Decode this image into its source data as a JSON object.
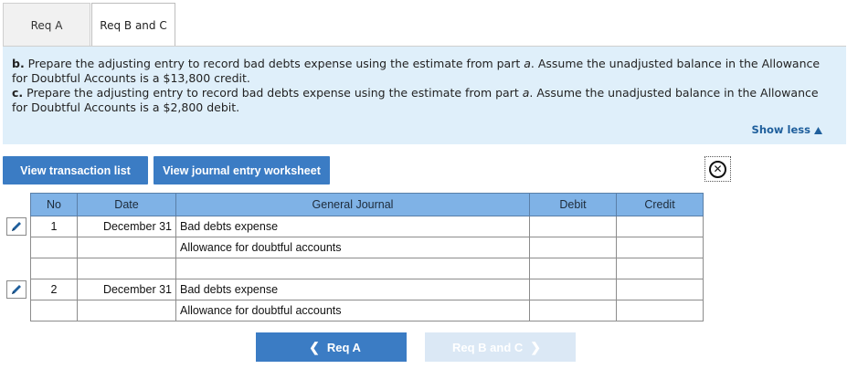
{
  "tabs": [
    {
      "label": "Req A",
      "active": false
    },
    {
      "label": "Req B and C",
      "active": true
    }
  ],
  "instructions": {
    "b_label": "b.",
    "b_text_1": " Prepare the adjusting entry to record bad debts expense using the estimate from part ",
    "b_part": "a",
    "b_text_2": ". Assume the unadjusted balance in the Allowance for Doubtful Accounts is a $13,800 credit.",
    "c_label": "c.",
    "c_text_1": " Prepare the adjusting entry to record bad debts expense using the estimate from part ",
    "c_part": "a",
    "c_text_2": ". Assume the unadjusted balance in the Allowance for Doubtful Accounts is a $2,800 debit.",
    "show_less": "Show less"
  },
  "toolbar": {
    "view_transactions": "View transaction list",
    "view_worksheet": "View journal entry worksheet"
  },
  "journal": {
    "headers": {
      "no": "No",
      "date": "Date",
      "general_journal": "General Journal",
      "debit": "Debit",
      "credit": "Credit"
    },
    "rows": [
      {
        "no": "1",
        "date": "December 31",
        "account": "Bad debts expense",
        "debit": "",
        "credit": ""
      },
      {
        "no": "",
        "date": "",
        "account": "Allowance for doubtful accounts",
        "debit": "",
        "credit": ""
      },
      {
        "no": "",
        "date": "",
        "account": "",
        "debit": "",
        "credit": ""
      },
      {
        "no": "2",
        "date": "December 31",
        "account": "Bad debts expense",
        "debit": "",
        "credit": ""
      },
      {
        "no": "",
        "date": "",
        "account": "Allowance for doubtful accounts",
        "debit": "",
        "credit": ""
      }
    ]
  },
  "nav": {
    "prev_label": "Req A",
    "next_label": "Req B and C"
  },
  "colors": {
    "accent": "#3b7cc4",
    "header_bg": "#7fb2e6",
    "instructions_bg": "#dfeffa",
    "disabled_button": "#dbe8f5"
  },
  "icons": {
    "edit": "pencil-icon",
    "close": "close-circle-icon",
    "show_less": "triangle-up-icon",
    "prev": "chevron-left-icon",
    "next": "chevron-right-icon"
  }
}
